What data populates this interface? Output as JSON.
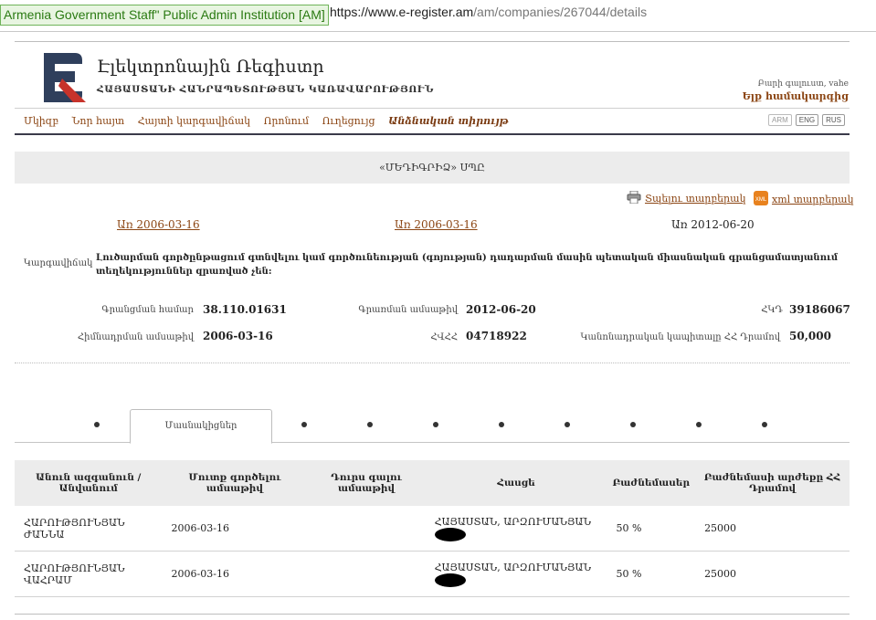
{
  "browser": {
    "ev_badge": "Armenia Government Staff\" Public Admin Institution [AM]",
    "url_host": "https://www.e-register.am",
    "url_path": "/am/companies/267044/details"
  },
  "header": {
    "title": "Էլեկտրոնային Ռեգիստր",
    "subtitle": "ՀԱՅԱՍՏԱՆԻ ՀԱՆՐԱՊԵՏՈՒԹՅԱՆ ԿԱՌԱՎԱՐՈՒԹՅՈՒՆ",
    "guest_text": "Բարի գալուստ, vahe",
    "logout": "Ելք համակարգից"
  },
  "menu": {
    "items": [
      "Մկիզբ",
      "Նոր հայտ",
      "Հայտի կարգավիճակ",
      "Որոնում",
      "Ուղեցույց",
      "Անձնական տիրույթ"
    ]
  },
  "languages": [
    "ARM",
    "ENG",
    "RUS"
  ],
  "company": {
    "name": "«ՄԵԴԻԳՐԻՁ» ՍՊԸ",
    "print_link": "Տպելու տարբերակ",
    "xml_link": "xml տարբերակ",
    "xml_icon_text": "XML",
    "date_link_1": "Առ 2006-03-16",
    "date_link_2": "Առ 2006-03-16",
    "date_current": "Առ 2012-06-20",
    "status_label": "Կարգավիճակ",
    "status_value": "Լուծարման գործընթացում գտնվելու կամ գործունեության (գոյության) դադարման մասին պետական միասնական գրանցամատյանում տեղեկություններ զրառված չեն:",
    "fields": {
      "reg_number_label": "Գրանցման համար",
      "reg_number": "38.110.01631",
      "reg_date_label": "Գրառման ամսաթիվ",
      "reg_date": "2012-06-20",
      "tin_label": "ՀՎՀՀ",
      "tin": "04718922",
      "zkd_label": "ՀԿԴ",
      "zkd": "39186067",
      "founding_date_label": "Հիմնադրման ամսաթիվ",
      "founding_date": "2006-03-16",
      "capital_label": "Կանոնադրական կապիտալը ՀՀ Դրամով",
      "capital": "50,000"
    }
  },
  "tabs": {
    "active_label": "Մասնակիցներ"
  },
  "table": {
    "headers": [
      "Անուն ազգանուն / Անվանում",
      "Մուտք գործելու ամսաթիվ",
      "Դուրս գալու ամսաթիվ",
      "Հասցե",
      "Բաժնեմասեր",
      "Բաժնեմասի արժեքը ՀՀ Դրամով"
    ],
    "rows": [
      {
        "name": "ՀԱՐՈՒԹՅՈՒՆՅԱՆ ԺԱՆՆԱ",
        "entry": "2006-03-16",
        "exit": "",
        "address": "ՀԱՅԱՍՏԱՆ, ԱՐԶՈՒՄԱՆՅԱՆ",
        "share": "50 %",
        "value": "25000"
      },
      {
        "name": "ՀԱՐՈՒԹՅՈՒՆՅԱՆ ՎԱՀՐԱՄ",
        "entry": "2006-03-16",
        "exit": "",
        "address": "ՀԱՅԱՍՏԱՆ, ԱՐԶՈՒՄԱՆՅԱՆ",
        "share": "50 %",
        "value": "25000"
      }
    ]
  }
}
